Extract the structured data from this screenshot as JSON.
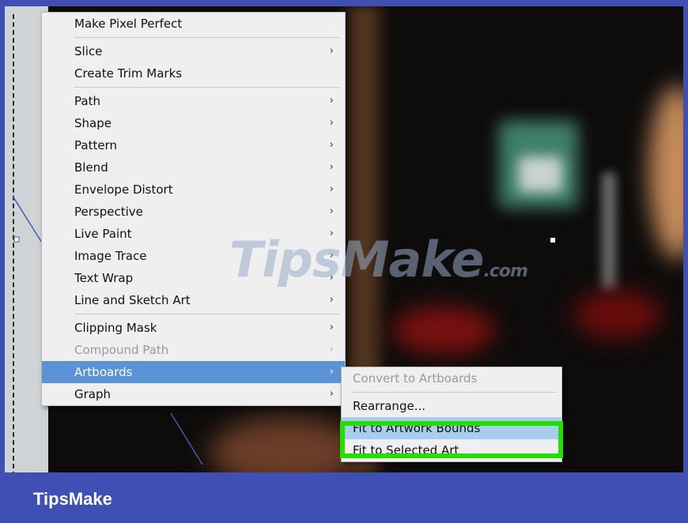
{
  "context_menu": {
    "groups": [
      [
        {
          "label": "Make Pixel Perfect",
          "submenu": false,
          "enabled": true
        }
      ],
      [
        {
          "label": "Slice",
          "submenu": true,
          "enabled": true
        },
        {
          "label": "Create Trim Marks",
          "submenu": false,
          "enabled": true
        }
      ],
      [
        {
          "label": "Path",
          "submenu": true,
          "enabled": true
        },
        {
          "label": "Shape",
          "submenu": true,
          "enabled": true
        },
        {
          "label": "Pattern",
          "submenu": true,
          "enabled": true
        },
        {
          "label": "Blend",
          "submenu": true,
          "enabled": true
        },
        {
          "label": "Envelope Distort",
          "submenu": true,
          "enabled": true
        },
        {
          "label": "Perspective",
          "submenu": true,
          "enabled": true
        },
        {
          "label": "Live Paint",
          "submenu": true,
          "enabled": true
        },
        {
          "label": "Image Trace",
          "submenu": true,
          "enabled": true
        },
        {
          "label": "Text Wrap",
          "submenu": true,
          "enabled": true
        },
        {
          "label": "Line and Sketch Art",
          "submenu": true,
          "enabled": true
        }
      ],
      [
        {
          "label": "Clipping Mask",
          "submenu": true,
          "enabled": true
        },
        {
          "label": "Compound Path",
          "submenu": true,
          "enabled": false
        },
        {
          "label": "Artboards",
          "submenu": true,
          "enabled": true,
          "highlighted": true
        },
        {
          "label": "Graph",
          "submenu": true,
          "enabled": true
        }
      ]
    ],
    "arrow_glyph": "›"
  },
  "artboards_submenu": {
    "groups": [
      [
        {
          "label": "Convert to Artboards",
          "enabled": false
        }
      ],
      [
        {
          "label": "Rearrange...",
          "enabled": true
        },
        {
          "label": "Fit to Artwork Bounds",
          "enabled": true,
          "highlighted": true
        },
        {
          "label": "Fit to Selected Art",
          "enabled": true
        }
      ]
    ]
  },
  "watermark": {
    "text": "TipsMake",
    "suffix": ".com"
  },
  "footer": {
    "brand": "TipsMake"
  },
  "colors": {
    "menu_highlight": "#5a94d6",
    "submenu_highlight": "#a8cdf0",
    "callout_green": "#22e000",
    "footer_bg": "#3f4fb4"
  }
}
